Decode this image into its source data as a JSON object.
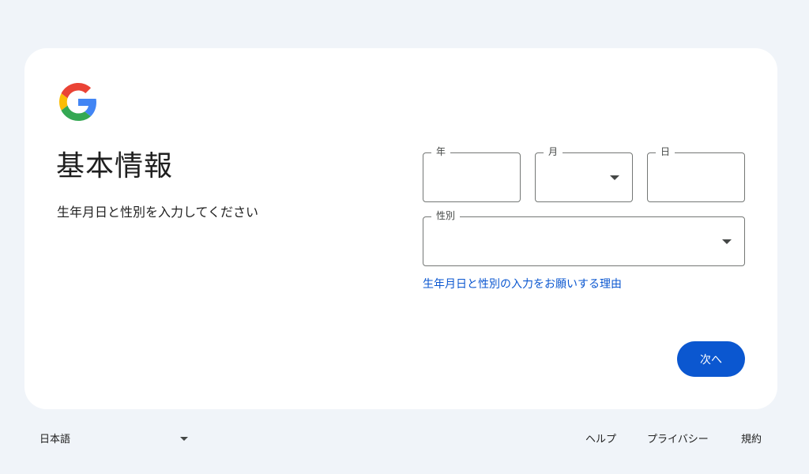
{
  "header": {
    "logo_icon": "google-g-icon",
    "title": "基本情報",
    "subtitle": "生年月日と性別を入力してください"
  },
  "form": {
    "year": {
      "label": "年",
      "value": ""
    },
    "month": {
      "label": "月",
      "value": "",
      "icon": "chevron-down-icon"
    },
    "day": {
      "label": "日",
      "value": ""
    },
    "gender": {
      "label": "性別",
      "value": "",
      "icon": "chevron-down-icon"
    },
    "why_link": "生年月日と性別の入力をお願いする理由",
    "next_button": "次へ"
  },
  "footer": {
    "language": "日本語",
    "help": "ヘルプ",
    "privacy": "プライバシー",
    "terms": "規約"
  },
  "colors": {
    "background": "#f0f4f9",
    "card": "#ffffff",
    "accent": "#0b57d0",
    "border": "#747775"
  }
}
